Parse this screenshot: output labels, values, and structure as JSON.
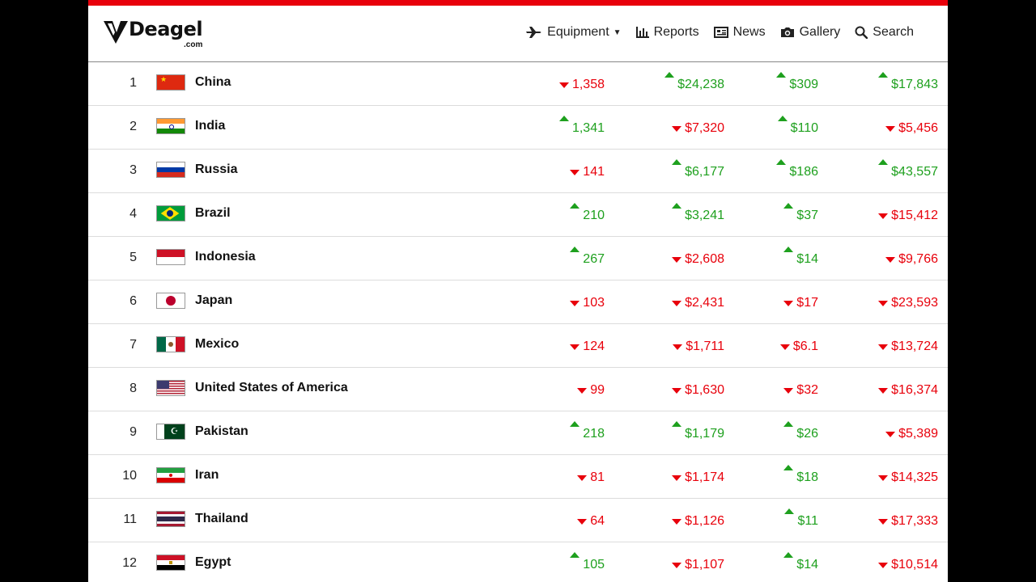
{
  "header": {
    "logo_text": "Deagel",
    "logo_sub": ".com",
    "nav": [
      {
        "label": "Equipment",
        "icon": "plane-icon"
      },
      {
        "label": "Reports",
        "icon": "bar-chart-icon"
      },
      {
        "label": "News",
        "icon": "newspaper-icon"
      },
      {
        "label": "Gallery",
        "icon": "camera-icon"
      },
      {
        "label": "Search",
        "icon": "search-icon"
      }
    ]
  },
  "colors": {
    "up": "#1ea01e",
    "down": "#e8000b",
    "topbar": "#e8000b"
  },
  "rows": [
    {
      "rank": "1",
      "name": "China",
      "flag": "cn",
      "values": [
        {
          "t": "1,358",
          "d": "down"
        },
        {
          "t": "$24,238",
          "d": "up"
        },
        {
          "t": "$309",
          "d": "up"
        },
        {
          "t": "$17,843",
          "d": "up"
        }
      ]
    },
    {
      "rank": "2",
      "name": "India",
      "flag": "in",
      "values": [
        {
          "t": "1,341",
          "d": "up"
        },
        {
          "t": "$7,320",
          "d": "down"
        },
        {
          "t": "$110",
          "d": "up"
        },
        {
          "t": "$5,456",
          "d": "down"
        }
      ]
    },
    {
      "rank": "3",
      "name": "Russia",
      "flag": "ru",
      "values": [
        {
          "t": "141",
          "d": "down"
        },
        {
          "t": "$6,177",
          "d": "up"
        },
        {
          "t": "$186",
          "d": "up"
        },
        {
          "t": "$43,557",
          "d": "up"
        }
      ]
    },
    {
      "rank": "4",
      "name": "Brazil",
      "flag": "br",
      "values": [
        {
          "t": "210",
          "d": "up"
        },
        {
          "t": "$3,241",
          "d": "up"
        },
        {
          "t": "$37",
          "d": "up"
        },
        {
          "t": "$15,412",
          "d": "down"
        }
      ]
    },
    {
      "rank": "5",
      "name": "Indonesia",
      "flag": "id",
      "values": [
        {
          "t": "267",
          "d": "up"
        },
        {
          "t": "$2,608",
          "d": "down"
        },
        {
          "t": "$14",
          "d": "up"
        },
        {
          "t": "$9,766",
          "d": "down"
        }
      ]
    },
    {
      "rank": "6",
      "name": "Japan",
      "flag": "jp",
      "values": [
        {
          "t": "103",
          "d": "down"
        },
        {
          "t": "$2,431",
          "d": "down"
        },
        {
          "t": "$17",
          "d": "down"
        },
        {
          "t": "$23,593",
          "d": "down"
        }
      ]
    },
    {
      "rank": "7",
      "name": "Mexico",
      "flag": "mx",
      "values": [
        {
          "t": "124",
          "d": "down"
        },
        {
          "t": "$1,711",
          "d": "down"
        },
        {
          "t": "$6.1",
          "d": "down"
        },
        {
          "t": "$13,724",
          "d": "down"
        }
      ]
    },
    {
      "rank": "8",
      "name": "United States of America",
      "flag": "us",
      "values": [
        {
          "t": "99",
          "d": "down"
        },
        {
          "t": "$1,630",
          "d": "down"
        },
        {
          "t": "$32",
          "d": "down"
        },
        {
          "t": "$16,374",
          "d": "down"
        }
      ]
    },
    {
      "rank": "9",
      "name": "Pakistan",
      "flag": "pk",
      "values": [
        {
          "t": "218",
          "d": "up"
        },
        {
          "t": "$1,179",
          "d": "up"
        },
        {
          "t": "$26",
          "d": "up"
        },
        {
          "t": "$5,389",
          "d": "down"
        }
      ]
    },
    {
      "rank": "10",
      "name": "Iran",
      "flag": "ir",
      "values": [
        {
          "t": "81",
          "d": "down"
        },
        {
          "t": "$1,174",
          "d": "down"
        },
        {
          "t": "$18",
          "d": "up"
        },
        {
          "t": "$14,325",
          "d": "down"
        }
      ]
    },
    {
      "rank": "11",
      "name": "Thailand",
      "flag": "th",
      "values": [
        {
          "t": "64",
          "d": "down"
        },
        {
          "t": "$1,126",
          "d": "down"
        },
        {
          "t": "$11",
          "d": "up"
        },
        {
          "t": "$17,333",
          "d": "down"
        }
      ]
    },
    {
      "rank": "12",
      "name": "Egypt",
      "flag": "eg",
      "values": [
        {
          "t": "105",
          "d": "up"
        },
        {
          "t": "$1,107",
          "d": "down"
        },
        {
          "t": "$14",
          "d": "up"
        },
        {
          "t": "$10,514",
          "d": "down"
        }
      ]
    }
  ]
}
